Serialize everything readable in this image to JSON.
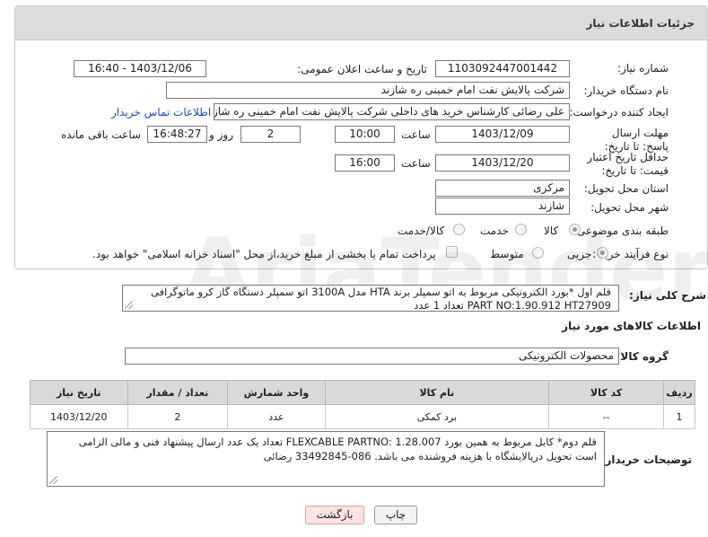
{
  "header": {
    "title": "جزئیات اطلاعات نیاز"
  },
  "form": {
    "need_number_label": "شماره نیاز:",
    "need_number": "1103092447001442",
    "announce_label": "تاریخ و ساعت اعلان عمومی:",
    "announce_value": "1403/12/06 - 16:40",
    "buyer_org_label": "نام دستگاه خریدار:",
    "buyer_org": "شرکت پالایش نفت امام خمینی  ره  شازند",
    "requester_label": "ایجاد کننده درخواست:",
    "requester": "علی  رضائی کارشناس خرید های داخلی  شرکت پالایش نفت امام خمینی  ره  شازند",
    "contact_link": "اطلاعات تماس خریدار",
    "deadline_label": "مهلت ارسال پاسخ: تا تاریخ:",
    "deadline_date": "1403/12/09",
    "time_word": "ساعت",
    "deadline_time": "10:00",
    "days_value": "2",
    "days_word": "روز و",
    "remaining_time": "16:48:27",
    "remaining_word": "ساعت باقی مانده",
    "validity_label": "حداقل تاریخ اعتبار قیمت: تا تاریخ:",
    "validity_date": "1403/12/20",
    "validity_time": "16:00",
    "province_label": "استان محل تحویل:",
    "province": "مرکزی",
    "city_label": "شهر محل تحویل:",
    "city": "شازند",
    "category_label": "طبقه بندی موضوعی:",
    "category_options": [
      "کالا",
      "خدمت",
      "کالا/خدمت"
    ],
    "process_label": "نوع فرآیند خرید :",
    "process_options": [
      "جزیی",
      "متوسط"
    ],
    "payment_note": "پرداخت تمام یا بخشی از مبلغ خرید،از محل \"اسناد خزانه اسلامی\" خواهد بود."
  },
  "description": {
    "label": "شرح کلی نیاز:",
    "line1": "قلم اول  *بورد الکترونیکی مربوط به اتو سمپلر برند HTA مدل 3100A  اتو سمپلر دستگاه گاز کرو ماتوگرافی",
    "line2": "PART NO:1.90.912    HT27909   تعداد 1 عدد"
  },
  "goods_section": {
    "title": "اطلاعات کالاهای مورد نیاز",
    "group_label": "گروه کالا:",
    "group_value": "محصولات الکترونیکی"
  },
  "table": {
    "headers": [
      "ردیف",
      "کد کالا",
      "نام کالا",
      "واحد شمارش",
      "تعداد / مقدار",
      "تاریخ نیاز"
    ],
    "rows": [
      {
        "row": "1",
        "code": "--",
        "name": "برد کمکی",
        "unit": "عدد",
        "qty": "2",
        "date": "1403/12/20"
      }
    ]
  },
  "buyer_notes": {
    "label": "توضیحات خریدار:",
    "line1": "قلم دوم*  کابل مربوط به همین بورد FLEXCABLE PARTNO: 1.28.007  تعداد  یک عدد ارسال پیشنهاد فنی و مالی الزامی",
    "line2": "است  تحویل درپالایشگاه با هزینه فروشنده می باشد.  086-33492845  رضائی"
  },
  "buttons": {
    "print": "چاپ",
    "back": "بازگشت"
  },
  "watermark": "AriaTender.neT"
}
